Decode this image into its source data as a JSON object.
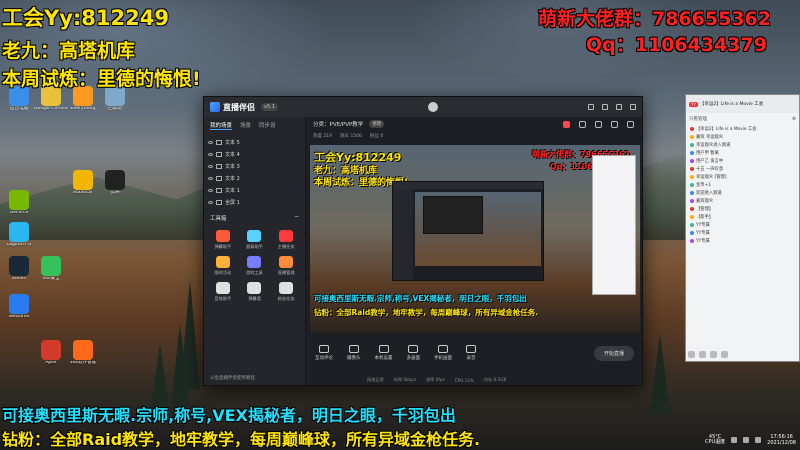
{
  "overlay": {
    "guild": "工会Yy:812249",
    "support": "老九：高塔机库",
    "weekly": "本周试炼：里德的悔恨!",
    "group": "萌新大佬群：786655362",
    "qq": "Qq：1106434379",
    "services": "可接奥西里斯无暇.宗师,称号,VEX揭秘者，明日之眼，千羽包出",
    "fans": "钻粉：全部Raid教学，地牢教学，每周巅峰球，所有异域金枪任务."
  },
  "desktop_icons": [
    {
      "label": "这台电脑",
      "color": "#3b8fe8"
    },
    {
      "label": "Google Chrome",
      "color": "#e8c23b"
    },
    {
      "label": "Everything",
      "color": "#ff9a1f"
    },
    {
      "label": "回收站",
      "color": "#7fa9c9"
    },
    {
      "label": "Rockstar",
      "color": "#f2b500"
    },
    {
      "label": "剪映",
      "color": "#222"
    },
    {
      "label": "GeForce",
      "color": "#76b900"
    },
    {
      "label": "Logitech G",
      "color": "#2ab7f0"
    },
    {
      "label": "Steam",
      "color": "#1b2838"
    },
    {
      "label": "360安全",
      "color": "#35c25a"
    },
    {
      "label": "WeGame",
      "color": "#2a7df0"
    },
    {
      "label": "Apex",
      "color": "#d23b2b"
    },
    {
      "label": "360软件管家",
      "color": "#ff6a1a"
    }
  ],
  "app": {
    "title": "直播伴侣",
    "version": "v5.1",
    "tabs": [
      "我的场景",
      "场景",
      "同步设"
    ],
    "scenes": [
      "文本 5",
      "文本 4",
      "文本 3",
      "文本 2",
      "文本 1",
      "全屏 1"
    ],
    "tools_title": "工具箱",
    "tools": [
      {
        "label": "弹幕助手",
        "color": "#ff5a3a"
      },
      {
        "label": "超级助手",
        "color": "#5ad0ff"
      },
      {
        "label": "主播任务",
        "color": "#ff3a3a"
      },
      {
        "label": "限时活动",
        "color": "#ffb13a"
      },
      {
        "label": "游戏工具",
        "color": "#7a7cff"
      },
      {
        "label": "直播管理",
        "color": "#ff8a3a"
      },
      {
        "label": "音效助手",
        "color": "#e0e0e0"
      },
      {
        "label": "弹幕墙",
        "color": "#e0e0e0"
      },
      {
        "label": "粉丝任务",
        "color": "#e0e0e0"
      }
    ],
    "footer_tip": "斗鱼直播伴侣使用教程",
    "category": "分类：PVE/PVP教学",
    "category_btn": "修改",
    "stats": [
      "热度 219",
      "观众 1506",
      "粉丝 0"
    ],
    "controls": [
      "互动评论",
      "摄像头",
      "本机设置",
      "多画面",
      "手机画面",
      "录音"
    ],
    "golive": "开始直播",
    "status": [
      "网络正常",
      "码率 0kbps",
      "帧率 0fps",
      "CPU 12%",
      "内存 8.5GB"
    ]
  },
  "chat": {
    "title": "【幸运2】Life is a Movie 工会",
    "filter": "只看管理",
    "lines": [
      "【幸运2】Life is a Movie 工会",
      "嘉宾 幸运观众",
      "幸运观众进入频道",
      "用户甲 暂离",
      "用户乙 发言中",
      "十五 一声叹息",
      "幸运观众 [管理]",
      "金币+1",
      "欢迎进入频道",
      "嘉宾观众",
      "【管理】",
      "【新手】",
      "YY专属",
      "YY专属",
      "YY专属"
    ]
  },
  "tray": {
    "temp": "45°C",
    "temp_label": "CPU温度",
    "time": "17:56:16",
    "date": "2021/12/08"
  }
}
